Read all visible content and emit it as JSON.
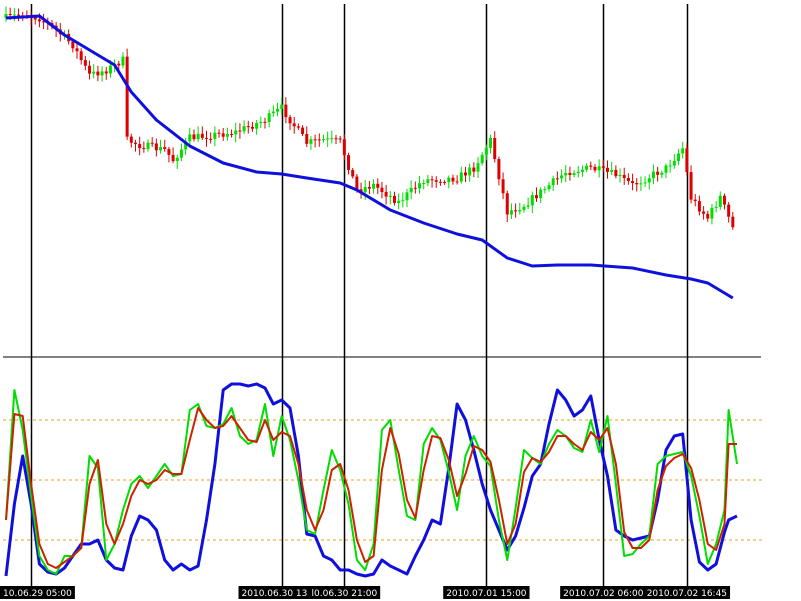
{
  "chart_data": {
    "type": "candlestick",
    "title": "",
    "colors": {
      "up_candle": "#00dd00",
      "down_candle": "#dd0000",
      "moving_average": "#1010dd",
      "osc_main": "#00dd00",
      "osc_signal": "#cc2200",
      "osc_third": "#1010dd",
      "osc_levels": "#e8a020",
      "separators": "#000000",
      "tick_label_bg": "#000000",
      "tick_label_text": "#ffffff"
    },
    "x_axis": {
      "bar_count": 175,
      "tick_labels": [
        {
          "label": "10.06.29 05:00",
          "bar": 6
        },
        {
          "label": "2010.06.30 13:00",
          "bar": 66
        },
        {
          "label": "l0.06.30 21:00",
          "bar": 81
        },
        {
          "label": "2010.07.01 15:00",
          "bar": 115
        },
        {
          "label": "2010.07.02 06:00",
          "bar": 143
        },
        {
          "label": "2010.07.02 16:45",
          "bar": 163
        }
      ]
    },
    "separators_at_bars": [
      6,
      66,
      81,
      115,
      143,
      163
    ],
    "price_panel": {
      "anchors": [
        [
          0,
          18
        ],
        [
          4,
          14
        ],
        [
          8,
          18
        ],
        [
          12,
          30
        ],
        [
          16,
          45
        ],
        [
          20,
          75
        ],
        [
          24,
          70
        ],
        [
          28,
          60
        ],
        [
          29,
          140
        ],
        [
          32,
          145
        ],
        [
          38,
          150
        ],
        [
          40,
          160
        ],
        [
          44,
          138
        ],
        [
          55,
          132
        ],
        [
          62,
          120
        ],
        [
          66,
          108
        ],
        [
          72,
          143
        ],
        [
          76,
          140
        ],
        [
          80,
          142
        ],
        [
          84,
          190
        ],
        [
          88,
          185
        ],
        [
          94,
          202
        ],
        [
          100,
          180
        ],
        [
          108,
          178
        ],
        [
          112,
          168
        ],
        [
          116,
          140
        ],
        [
          120,
          212
        ],
        [
          124,
          205
        ],
        [
          128,
          192
        ],
        [
          134,
          172
        ],
        [
          140,
          168
        ],
        [
          146,
          175
        ],
        [
          150,
          185
        ],
        [
          158,
          168
        ],
        [
          162,
          148
        ],
        [
          164,
          198
        ],
        [
          168,
          218
        ],
        [
          171,
          197
        ],
        [
          174,
          228
        ]
      ],
      "moving_average": [
        [
          0,
          18
        ],
        [
          8,
          16
        ],
        [
          14,
          35
        ],
        [
          20,
          50
        ],
        [
          26,
          65
        ],
        [
          30,
          92
        ],
        [
          36,
          120
        ],
        [
          44,
          146
        ],
        [
          52,
          163
        ],
        [
          60,
          172
        ],
        [
          66,
          174
        ],
        [
          72,
          178
        ],
        [
          80,
          183
        ],
        [
          84,
          190
        ],
        [
          92,
          210
        ],
        [
          100,
          223
        ],
        [
          108,
          234
        ],
        [
          114,
          240
        ],
        [
          120,
          258
        ],
        [
          126,
          266
        ],
        [
          132,
          265
        ],
        [
          140,
          265
        ],
        [
          150,
          268
        ],
        [
          158,
          275
        ],
        [
          164,
          279
        ],
        [
          168,
          283
        ],
        [
          174,
          298
        ]
      ],
      "baseline": 300
    },
    "oscillator_panel": {
      "levels": [
        80,
        50,
        20
      ],
      "main_line": [
        [
          0,
          30
        ],
        [
          2,
          95
        ],
        [
          4,
          75
        ],
        [
          6,
          42
        ],
        [
          8,
          12
        ],
        [
          10,
          5
        ],
        [
          12,
          3
        ],
        [
          14,
          12
        ],
        [
          16,
          12
        ],
        [
          18,
          16
        ],
        [
          20,
          62
        ],
        [
          22,
          56
        ],
        [
          24,
          10
        ],
        [
          26,
          18
        ],
        [
          28,
          35
        ],
        [
          30,
          48
        ],
        [
          32,
          52
        ],
        [
          34,
          46
        ],
        [
          36,
          52
        ],
        [
          38,
          58
        ],
        [
          40,
          52
        ],
        [
          42,
          53
        ],
        [
          44,
          85
        ],
        [
          46,
          88
        ],
        [
          48,
          77
        ],
        [
          50,
          76
        ],
        [
          52,
          78
        ],
        [
          54,
          86
        ],
        [
          56,
          72
        ],
        [
          58,
          68
        ],
        [
          60,
          70
        ],
        [
          62,
          88
        ],
        [
          64,
          62
        ],
        [
          66,
          82
        ],
        [
          68,
          70
        ],
        [
          70,
          50
        ],
        [
          72,
          25
        ],
        [
          74,
          23
        ],
        [
          76,
          45
        ],
        [
          78,
          65
        ],
        [
          80,
          55
        ],
        [
          82,
          38
        ],
        [
          84,
          10
        ],
        [
          86,
          5
        ],
        [
          88,
          18
        ],
        [
          90,
          75
        ],
        [
          92,
          80
        ],
        [
          94,
          55
        ],
        [
          96,
          32
        ],
        [
          98,
          30
        ],
        [
          100,
          68
        ],
        [
          102,
          76
        ],
        [
          104,
          70
        ],
        [
          106,
          54
        ],
        [
          108,
          35
        ],
        [
          110,
          62
        ],
        [
          112,
          72
        ],
        [
          114,
          62
        ],
        [
          116,
          57
        ],
        [
          118,
          30
        ],
        [
          120,
          10
        ],
        [
          122,
          36
        ],
        [
          124,
          65
        ],
        [
          126,
          61
        ],
        [
          128,
          58
        ],
        [
          130,
          68
        ],
        [
          132,
          75
        ],
        [
          134,
          72
        ],
        [
          136,
          66
        ],
        [
          138,
          64
        ],
        [
          140,
          80
        ],
        [
          142,
          64
        ],
        [
          144,
          82
        ],
        [
          146,
          48
        ],
        [
          148,
          12
        ],
        [
          150,
          13
        ],
        [
          152,
          18
        ],
        [
          154,
          22
        ],
        [
          156,
          58
        ],
        [
          158,
          62
        ],
        [
          160,
          63
        ],
        [
          162,
          64
        ],
        [
          164,
          52
        ],
        [
          166,
          32
        ],
        [
          168,
          8
        ],
        [
          170,
          18
        ],
        [
          172,
          35
        ],
        [
          173,
          85
        ],
        [
          175,
          58
        ]
      ],
      "signal_line": [
        [
          0,
          30
        ],
        [
          2,
          83
        ],
        [
          4,
          82
        ],
        [
          6,
          48
        ],
        [
          8,
          18
        ],
        [
          10,
          8
        ],
        [
          12,
          6
        ],
        [
          14,
          9
        ],
        [
          16,
          12
        ],
        [
          18,
          16
        ],
        [
          20,
          48
        ],
        [
          22,
          60
        ],
        [
          24,
          28
        ],
        [
          26,
          18
        ],
        [
          28,
          28
        ],
        [
          30,
          42
        ],
        [
          32,
          50
        ],
        [
          34,
          48
        ],
        [
          36,
          50
        ],
        [
          38,
          55
        ],
        [
          40,
          53
        ],
        [
          42,
          53
        ],
        [
          44,
          70
        ],
        [
          46,
          86
        ],
        [
          48,
          80
        ],
        [
          50,
          76
        ],
        [
          52,
          77
        ],
        [
          54,
          82
        ],
        [
          56,
          76
        ],
        [
          58,
          70
        ],
        [
          60,
          69
        ],
        [
          62,
          80
        ],
        [
          64,
          70
        ],
        [
          66,
          74
        ],
        [
          68,
          72
        ],
        [
          70,
          58
        ],
        [
          72,
          35
        ],
        [
          74,
          25
        ],
        [
          76,
          35
        ],
        [
          78,
          55
        ],
        [
          80,
          58
        ],
        [
          82,
          45
        ],
        [
          84,
          20
        ],
        [
          86,
          9
        ],
        [
          88,
          12
        ],
        [
          90,
          55
        ],
        [
          92,
          76
        ],
        [
          94,
          63
        ],
        [
          96,
          40
        ],
        [
          98,
          31
        ],
        [
          100,
          55
        ],
        [
          102,
          72
        ],
        [
          104,
          71
        ],
        [
          106,
          60
        ],
        [
          108,
          42
        ],
        [
          110,
          53
        ],
        [
          112,
          67
        ],
        [
          114,
          65
        ],
        [
          116,
          59
        ],
        [
          118,
          40
        ],
        [
          120,
          18
        ],
        [
          122,
          28
        ],
        [
          124,
          54
        ],
        [
          126,
          61
        ],
        [
          128,
          59
        ],
        [
          130,
          64
        ],
        [
          132,
          72
        ],
        [
          134,
          72
        ],
        [
          136,
          68
        ],
        [
          138,
          65
        ],
        [
          140,
          74
        ],
        [
          142,
          70
        ],
        [
          144,
          76
        ],
        [
          146,
          58
        ],
        [
          148,
          24
        ],
        [
          150,
          16
        ],
        [
          152,
          16
        ],
        [
          154,
          20
        ],
        [
          156,
          45
        ],
        [
          158,
          57
        ],
        [
          160,
          61
        ],
        [
          162,
          63
        ],
        [
          164,
          56
        ],
        [
          166,
          40
        ],
        [
          168,
          18
        ],
        [
          170,
          15
        ],
        [
          172,
          28
        ],
        [
          173,
          68
        ],
        [
          175,
          68
        ]
      ],
      "third_line": [
        [
          0,
          2
        ],
        [
          2,
          38
        ],
        [
          4,
          62
        ],
        [
          6,
          38
        ],
        [
          8,
          8
        ],
        [
          10,
          4
        ],
        [
          12,
          3
        ],
        [
          14,
          6
        ],
        [
          16,
          12
        ],
        [
          18,
          18
        ],
        [
          20,
          18
        ],
        [
          22,
          20
        ],
        [
          24,
          10
        ],
        [
          26,
          6
        ],
        [
          28,
          5
        ],
        [
          30,
          22
        ],
        [
          32,
          32
        ],
        [
          34,
          30
        ],
        [
          36,
          25
        ],
        [
          38,
          10
        ],
        [
          40,
          5
        ],
        [
          42,
          8
        ],
        [
          44,
          5
        ],
        [
          46,
          7
        ],
        [
          48,
          30
        ],
        [
          50,
          58
        ],
        [
          52,
          95
        ],
        [
          54,
          98
        ],
        [
          56,
          98
        ],
        [
          58,
          97
        ],
        [
          60,
          98
        ],
        [
          62,
          96
        ],
        [
          64,
          88
        ],
        [
          66,
          90
        ],
        [
          68,
          86
        ],
        [
          70,
          62
        ],
        [
          72,
          23
        ],
        [
          74,
          22
        ],
        [
          76,
          12
        ],
        [
          78,
          10
        ],
        [
          80,
          5
        ],
        [
          82,
          5
        ],
        [
          84,
          3
        ],
        [
          86,
          2
        ],
        [
          88,
          3
        ],
        [
          90,
          10
        ],
        [
          92,
          7
        ],
        [
          94,
          5
        ],
        [
          96,
          3
        ],
        [
          98,
          12
        ],
        [
          100,
          20
        ],
        [
          102,
          30
        ],
        [
          104,
          28
        ],
        [
          106,
          56
        ],
        [
          108,
          88
        ],
        [
          110,
          80
        ],
        [
          112,
          65
        ],
        [
          114,
          48
        ],
        [
          116,
          35
        ],
        [
          118,
          25
        ],
        [
          120,
          15
        ],
        [
          122,
          22
        ],
        [
          124,
          36
        ],
        [
          126,
          52
        ],
        [
          128,
          58
        ],
        [
          130,
          78
        ],
        [
          132,
          95
        ],
        [
          134,
          90
        ],
        [
          136,
          82
        ],
        [
          138,
          85
        ],
        [
          140,
          92
        ],
        [
          142,
          70
        ],
        [
          144,
          52
        ],
        [
          146,
          25
        ],
        [
          148,
          22
        ],
        [
          150,
          20
        ],
        [
          152,
          21
        ],
        [
          154,
          22
        ],
        [
          156,
          40
        ],
        [
          158,
          65
        ],
        [
          160,
          72
        ],
        [
          162,
          73
        ],
        [
          164,
          30
        ],
        [
          166,
          9
        ],
        [
          168,
          5
        ],
        [
          170,
          8
        ],
        [
          172,
          24
        ],
        [
          173,
          30
        ],
        [
          175,
          32
        ]
      ]
    }
  }
}
